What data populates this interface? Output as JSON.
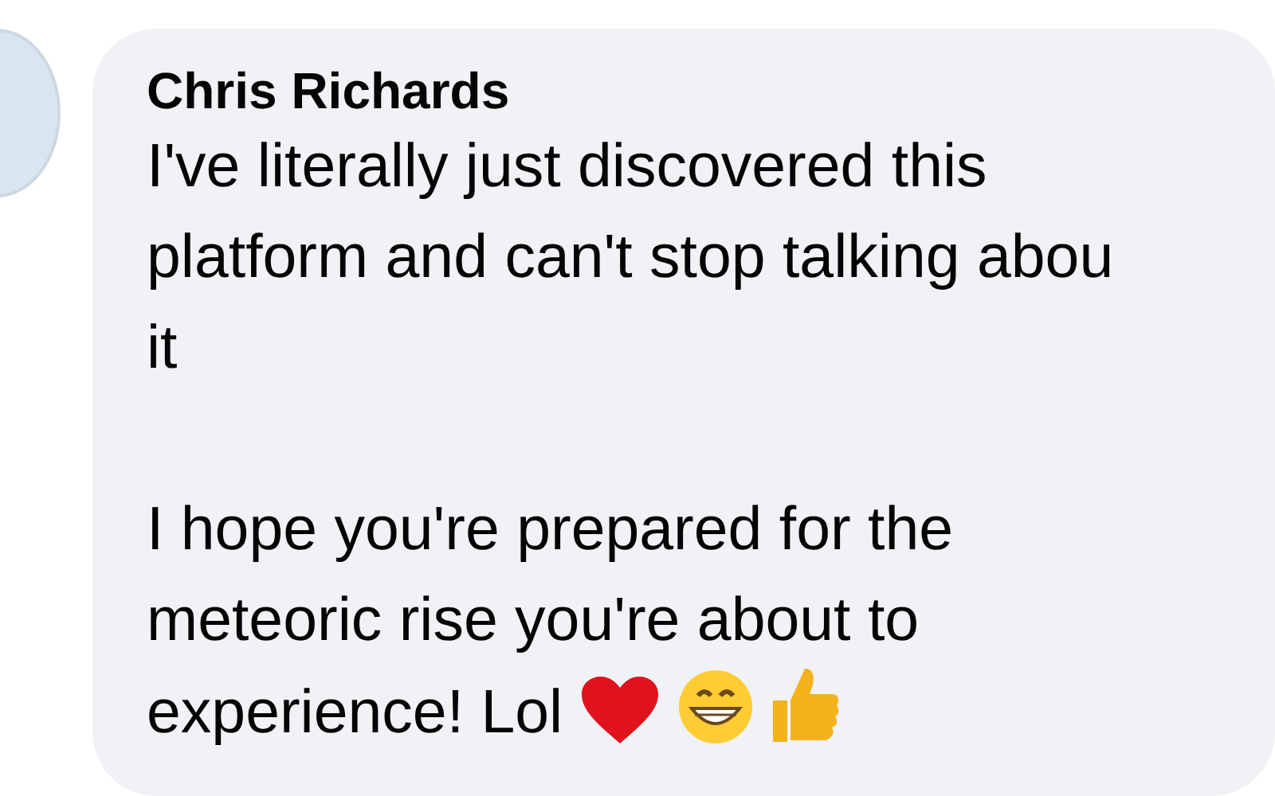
{
  "comment": {
    "author": "Chris Richards",
    "paragraphs": [
      [
        "I've literally just discovered this",
        "platform and can't stop talking abou",
        "it"
      ],
      [
        "I hope you're prepared for the",
        "meteoric rise you're about to",
        "experience! Lol"
      ]
    ]
  }
}
